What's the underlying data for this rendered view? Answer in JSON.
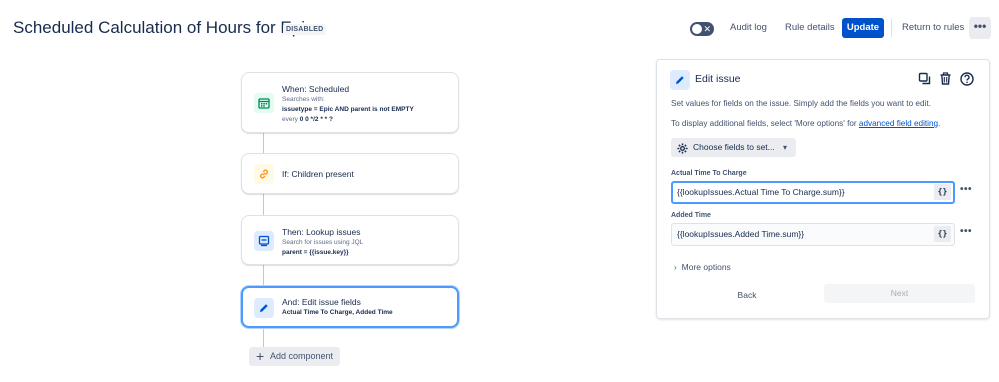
{
  "header": {
    "title": "Scheduled Calculation of Hours for Epics",
    "status_badge": "DISABLED",
    "toggle_symbol": "✕",
    "audit_log": "Audit log",
    "rule_details": "Rule details",
    "update": "Update",
    "return_to_rules": "Return to rules",
    "more": "•••"
  },
  "flow": {
    "trigger": {
      "title": "When: Scheduled",
      "sub": "Searches with:",
      "jql": "issuetype = Epic AND parent is not EMPTY",
      "cron_prefix": "every",
      "cron": "0 0 */2 * * ?",
      "icon": "calendar-icon"
    },
    "condition": {
      "title": "If: Children present",
      "icon": "link-icon"
    },
    "lookup": {
      "title": "Then: Lookup issues",
      "sub": "Search for issues using JQL",
      "jql": "parent = {{issue.key}}",
      "icon": "lookup-icon"
    },
    "edit": {
      "title": "And: Edit issue fields",
      "fields": "Actual Time To Charge, Added Time",
      "icon": "pencil-icon"
    },
    "add_component": "Add component"
  },
  "panel": {
    "title": "Edit issue",
    "desc1": "Set values for fields on the issue. Simply add the fields you want to edit.",
    "desc2_prefix": "To display additional fields, select 'More options' for ",
    "desc2_link": "advanced field editing",
    "desc2_suffix": ".",
    "choose_fields": "Choose fields to set...",
    "fields": [
      {
        "label": "Actual Time To Charge",
        "value": "{{lookupIssues.Actual Time To Charge.sum}}"
      },
      {
        "label": "Added Time",
        "value": "{{lookupIssues.Added Time.sum}}"
      }
    ],
    "smart_value_btn": "{}",
    "field_more": "•••",
    "more_options": "More options",
    "back": "Back",
    "next": "Next"
  },
  "colors": {
    "primary": "#0052cc",
    "selected_border": "#4c9aff",
    "trigger_icon_bg": "#e3fcef",
    "condition_icon_bg": "#fffae6",
    "action_icon_bg": "#deebff"
  }
}
